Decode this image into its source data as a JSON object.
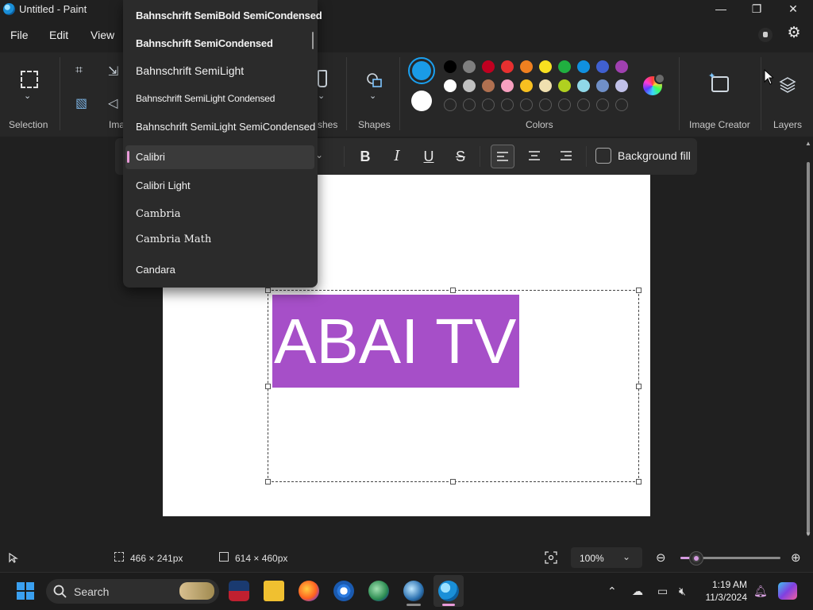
{
  "window": {
    "title": "Untitled - Paint",
    "minimize_glyph": "—",
    "restore_glyph": "❐",
    "close_glyph": "✕"
  },
  "menu": {
    "file": "File",
    "edit": "Edit",
    "view": "View"
  },
  "ribbon": {
    "groups": {
      "selection": "Selection",
      "image": "Ima",
      "brushes": "shes",
      "shapes": "Shapes",
      "colors": "Colors",
      "image_creator": "Image Creator",
      "layers": "Layers"
    }
  },
  "colors": {
    "primary": "#1a9be6",
    "secondary": "#ffffff",
    "palette_row1": [
      "#000000",
      "#7f7f7f",
      "#c00020",
      "#e83030",
      "#f08020",
      "#f8e020",
      "#20b040",
      "#1090e0",
      "#4060d0",
      "#a040b0"
    ],
    "palette_row2": [
      "#ffffff",
      "#c0c0c0",
      "#b07050",
      "#f8a0c0",
      "#f8c020",
      "#f0e0b0",
      "#b0d020",
      "#90d8e8",
      "#7090c8",
      "#c0c0e8"
    ]
  },
  "font_dropdown": {
    "items": [
      "Bahnschrift SemiBold SemiCondensed",
      "Bahnschrift SemiCondensed",
      "Bahnschrift SemiLight",
      "Bahnschrift SemiLight Condensed",
      "Bahnschrift SemiLight SemiCondensed",
      "Calibri",
      "Calibri Light",
      "Cambria",
      "Cambria Math",
      "Candara"
    ],
    "selected": "Calibri"
  },
  "text_toolbar": {
    "bold": "B",
    "italic": "I",
    "underline": "U",
    "strikethrough": "S",
    "background_fill": "Background fill"
  },
  "canvas": {
    "text": "ABAI TV",
    "text_bg": "#a64fc8"
  },
  "status": {
    "selection_size": "466 × 241px",
    "canvas_size": "614 × 460px",
    "zoom": "100%",
    "zoom_level_percent": 100
  },
  "taskbar": {
    "search_placeholder": "Search",
    "time": "1:19 AM",
    "date": "11/3/2024"
  }
}
